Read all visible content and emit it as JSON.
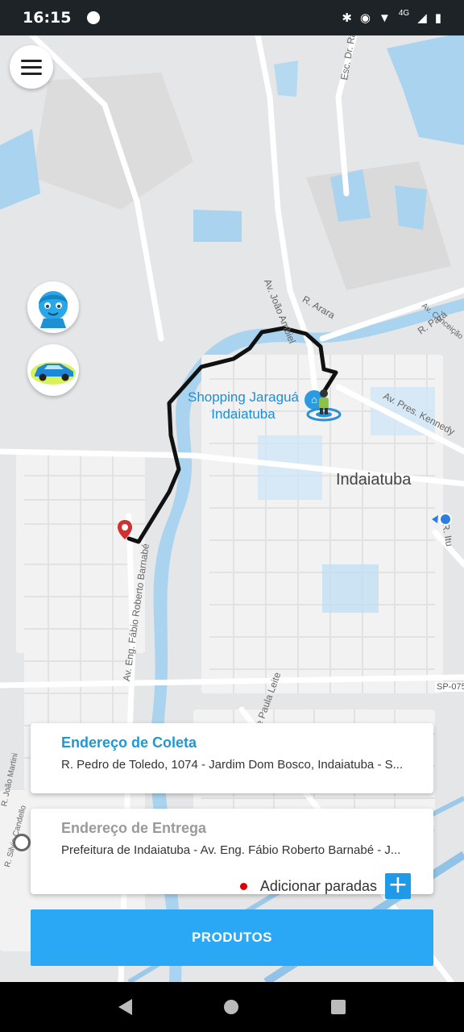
{
  "status_bar": {
    "time": "16:15",
    "network": "4G"
  },
  "map": {
    "streets": [
      "Esc. Dr. Rafael Elias José Aun",
      "Av. João Ambiel",
      "R. Arara",
      "Av. Conceição",
      "R. Pará",
      "Av. Pres. Kennedy",
      "R. Itu",
      "Av. Eng. Fábio Roberto Barnabé",
      "de Paula Leite",
      "SP-075",
      "R. João Martini",
      "R. Silvio Candello"
    ],
    "poi": "Shopping Jaraguá Indaiatuba",
    "city": "Indaiatuba"
  },
  "pickup": {
    "title": "Endereço de Coleta",
    "address": "R. Pedro de Toledo, 1074 - Jardim Dom Bosco, Indaiatuba - S..."
  },
  "delivery": {
    "title": "Endereço de Entrega",
    "address": "Prefeitura de Indaiatuba - Av. Eng. Fábio Roberto Barnabé - J...",
    "add_stops": "Adicionar paradas",
    "add_icon": "+"
  },
  "products_button": "PRODUTOS",
  "colors": {
    "accent": "#1e98d4",
    "button": "#2aa8f5",
    "route": "#111111"
  }
}
